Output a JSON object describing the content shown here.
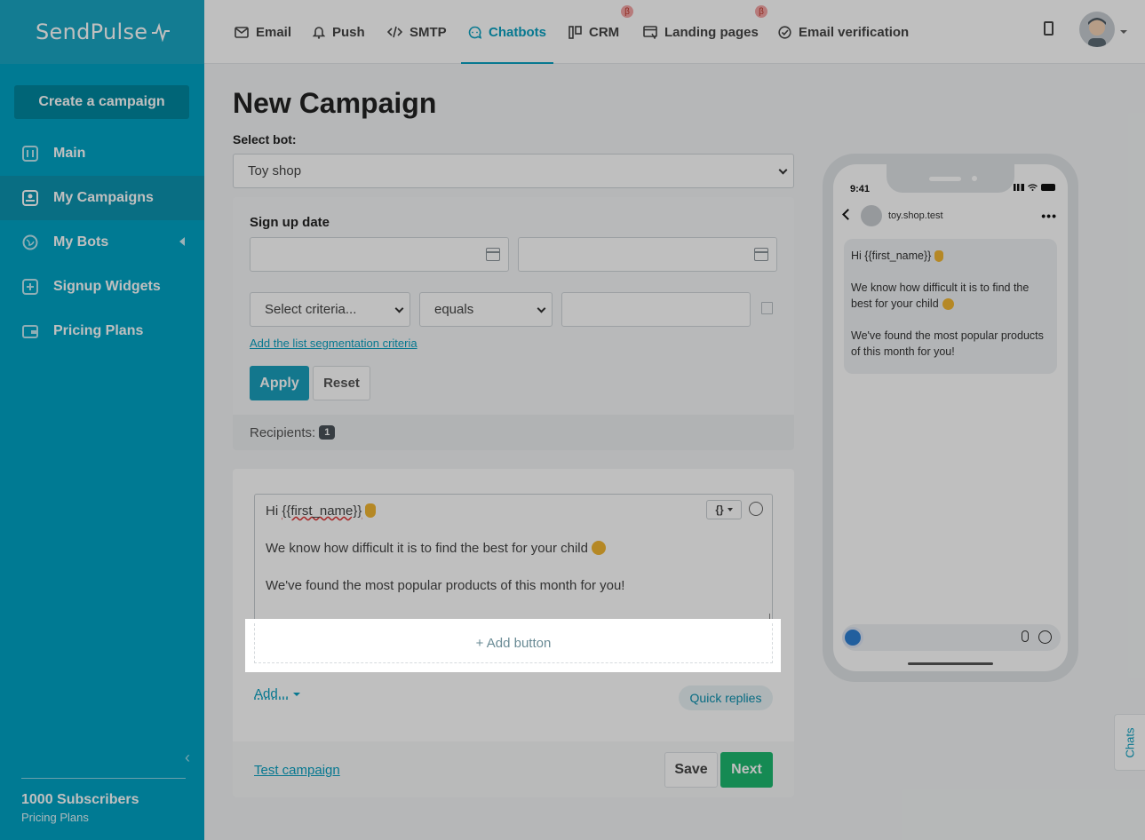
{
  "brand": {
    "name": "SendPulse"
  },
  "sidebar": {
    "create_label": "Create a campaign",
    "items": [
      {
        "label": "Main",
        "icon": "sliders-icon"
      },
      {
        "label": "My Campaigns",
        "icon": "campaigns-icon",
        "active": true
      },
      {
        "label": "My Bots",
        "icon": "globe-icon",
        "has_submenu": true
      },
      {
        "label": "Signup Widgets",
        "icon": "widget-icon"
      },
      {
        "label": "Pricing Plans",
        "icon": "wallet-icon"
      }
    ],
    "subscribers": "1000 Subscribers",
    "plan_link": "Pricing Plans"
  },
  "topnav": {
    "tabs": [
      {
        "label": "Email",
        "icon": "envelope-icon"
      },
      {
        "label": "Push",
        "icon": "bell-icon"
      },
      {
        "label": "SMTP",
        "icon": "code-icon"
      },
      {
        "label": "Chatbots",
        "icon": "chat-icon",
        "active": true
      },
      {
        "label": "CRM",
        "icon": "crm-icon",
        "beta": "β"
      },
      {
        "label": "Landing pages",
        "icon": "landing-icon",
        "beta": "β"
      },
      {
        "label": "Email verification",
        "icon": "check-circle-icon"
      }
    ]
  },
  "page": {
    "title": "New Campaign",
    "select_bot_label": "Select bot:",
    "selected_bot": "Toy shop"
  },
  "filters": {
    "section_title": "Sign up date",
    "date_from": "",
    "date_to": "",
    "criteria_placeholder": "Select criteria...",
    "operator": "equals",
    "criteria_value": "",
    "add_criteria_link": "Add the list segmentation criteria",
    "apply_label": "Apply",
    "reset_label": "Reset",
    "recipients_label": "Recipients:",
    "recipients_count": "1"
  },
  "message": {
    "line1_prefix": "Hi ",
    "line1_var": "{{first_name}}",
    "line2": "We know how difficult it is to find the best for your child",
    "line3": "We've found the most popular products of this month for you!",
    "var_button": "{}",
    "add_button": "+ Add button",
    "add_menu": "Add...",
    "quick_replies": "Quick replies"
  },
  "footer": {
    "test_link": "Test campaign",
    "save_label": "Save",
    "next_label": "Next"
  },
  "preview": {
    "time": "9:41",
    "chat_name": "toy.shop.test",
    "more": "•••",
    "bubble_line1": "Hi {{first_name}}",
    "bubble_line2": "We know how difficult it is to find the best for your child",
    "bubble_line3": "We've found the most popular products of this month for you!"
  },
  "chats_tab": "Chats",
  "colors": {
    "sidebar": "#00a3c4",
    "accent": "#0aa0c0",
    "next_button": "#1db86f"
  }
}
